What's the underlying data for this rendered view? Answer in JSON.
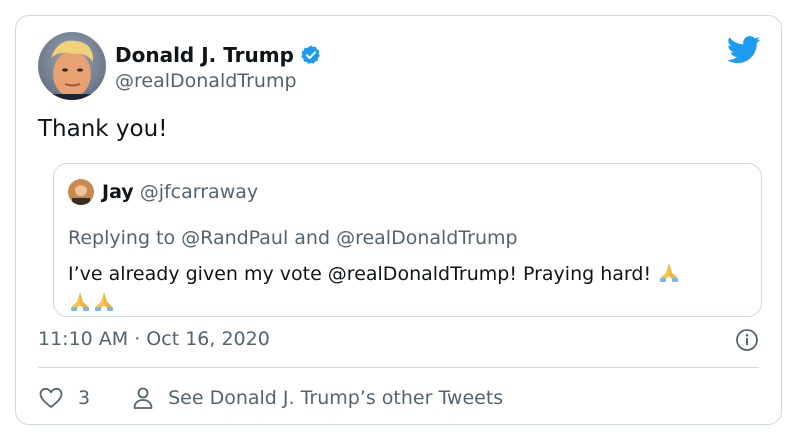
{
  "tweet": {
    "author_name": "Donald J. Trump",
    "author_handle": "@realDonaldTrump",
    "text": "Thank you!",
    "timestamp": "11:10 AM · Oct 16, 2020"
  },
  "quoted": {
    "author_name": "Jay",
    "author_handle": "@jfcarraway",
    "replying_to": "Replying to @RandPaul and @realDonaldTrump",
    "text": "I’ve already given my vote @realDonaldTrump! Praying hard!"
  },
  "actions": {
    "like_count": "3",
    "profile_link": "See Donald J. Trump’s other Tweets"
  },
  "icons": {
    "verified": "verified-badge-icon",
    "bird": "twitter-bird-icon",
    "info": "info-icon",
    "heart": "heart-icon",
    "person": "person-icon",
    "pray": "folded-hands-emoji"
  },
  "colors": {
    "accent": "#1d9bf0",
    "secondary_text": "#536471",
    "border": "#cfd9de"
  }
}
